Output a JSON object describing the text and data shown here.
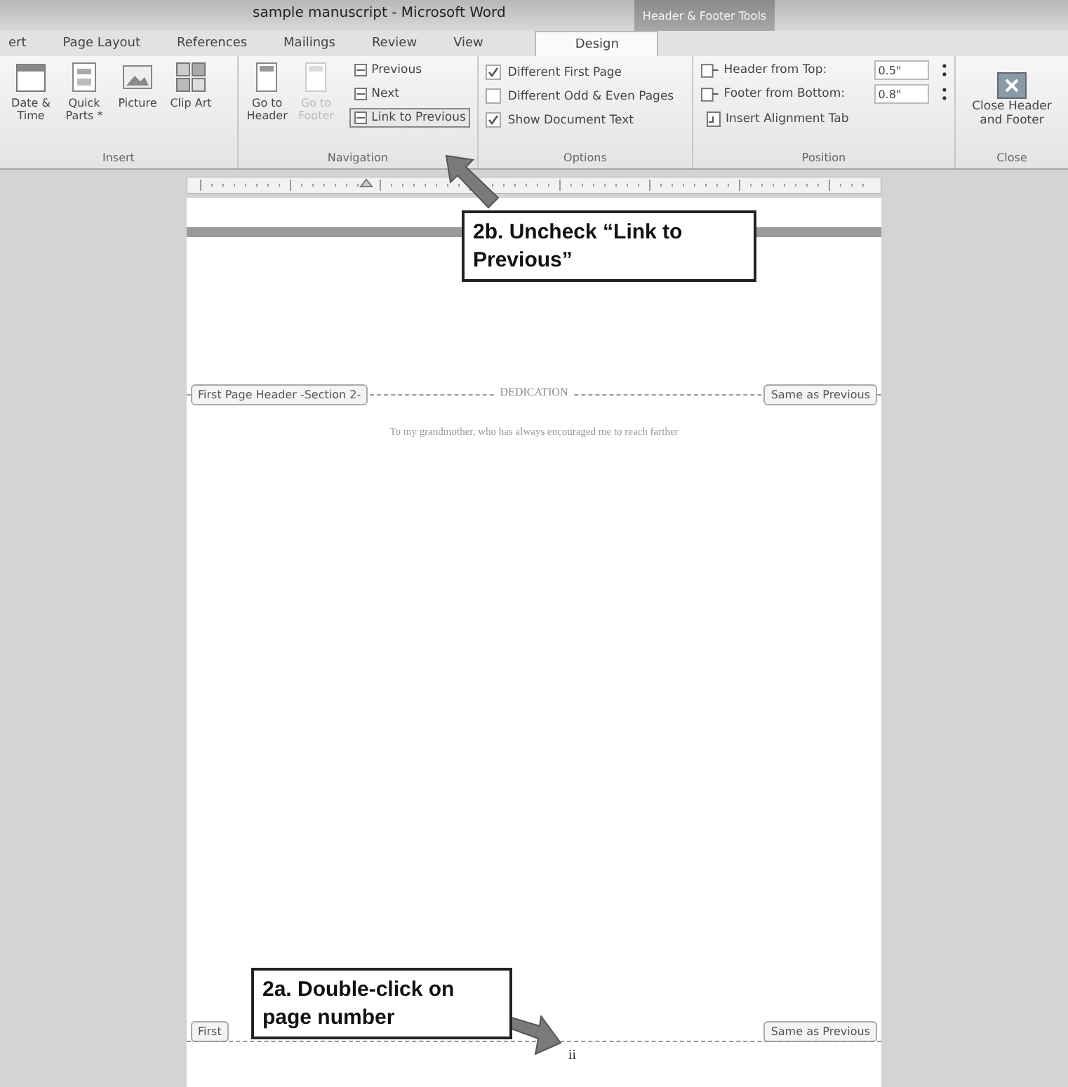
{
  "window": {
    "title": "sample manuscript - Microsoft Word",
    "contextual_title": "Header & Footer Tools"
  },
  "tabs": [
    {
      "label": "ert",
      "selected": false
    },
    {
      "label": "Page Layout",
      "selected": false
    },
    {
      "label": "References",
      "selected": false
    },
    {
      "label": "Mailings",
      "selected": false
    },
    {
      "label": "Review",
      "selected": false
    },
    {
      "label": "View",
      "selected": false
    },
    {
      "label": "Design",
      "selected": true
    }
  ],
  "ribbon": {
    "insert": {
      "label": "Insert",
      "buttons": [
        {
          "kind": "date",
          "label": "Date & Time"
        },
        {
          "kind": "parts",
          "label": "Quick Parts *"
        },
        {
          "kind": "picture",
          "label": "Picture"
        },
        {
          "kind": "clipart",
          "label": "Clip Art"
        }
      ]
    },
    "navigation": {
      "label": "Navigation",
      "buttons": [
        {
          "label": "Go to Header",
          "disabled": false
        },
        {
          "label": "Go to Footer",
          "disabled": true
        }
      ],
      "small_buttons": [
        {
          "label": "Previous",
          "selected": false
        },
        {
          "label": "Next",
          "selected": false
        },
        {
          "label": "Link to Previous",
          "selected": true
        }
      ]
    },
    "options": {
      "label": "Options",
      "checkboxes": [
        {
          "label": "Different First Page",
          "checked": true
        },
        {
          "label": "Different Odd & Even Pages",
          "checked": false
        },
        {
          "label": "Show Document Text",
          "checked": true
        }
      ]
    },
    "position": {
      "label": "Position",
      "fields": [
        {
          "label": "Header from Top:",
          "value": "0.5\""
        },
        {
          "label": "Footer from Bottom:",
          "value": "0.8\""
        }
      ],
      "button": "Insert Alignment Tab"
    },
    "close": {
      "label": "Close",
      "button": "Close Header and Footer"
    }
  },
  "document": {
    "header_tag": "First Page Header -Section 2-",
    "header_same": "Same as Previous",
    "heading": "DEDICATION",
    "paragraph": "To my grandmother, who has always encouraged me to reach farther",
    "footer_tag": "First",
    "footer_same": "Same as Previous",
    "page_number": "ii"
  },
  "callouts": [
    {
      "text": "2b. Uncheck “Link to Previous”"
    },
    {
      "text": "2a. Double-click on page number"
    }
  ]
}
